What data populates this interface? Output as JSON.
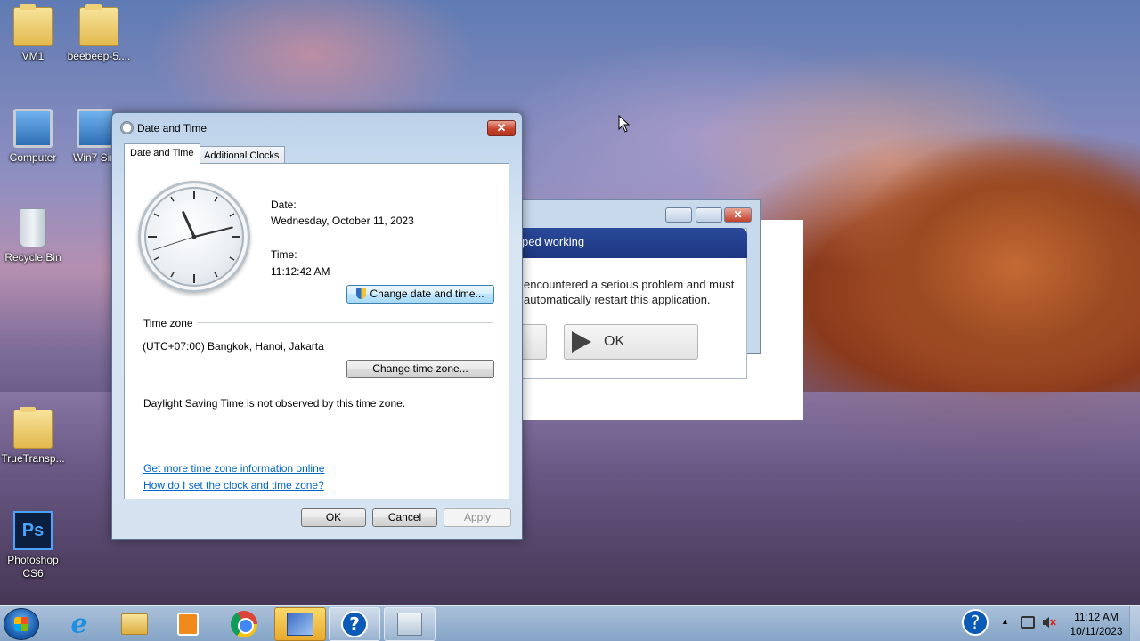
{
  "desktop": {
    "icons": [
      {
        "label": "VM1"
      },
      {
        "label": "beebeep-5...."
      },
      {
        "label": "Computer"
      },
      {
        "label": "Win7 Sim"
      },
      {
        "label": "Recycle Bin"
      },
      {
        "label": "TrueTransp..."
      },
      {
        "label": "Photoshop CS6"
      }
    ]
  },
  "error_window": {
    "banner": "ped working",
    "message": "encountered a serious problem and must\nautomatically restart this application.",
    "ok_label": "OK",
    "close_glyph": "✕"
  },
  "dialog": {
    "title": "Date and Time",
    "close_glyph": "✕",
    "tabs": [
      "Date and Time",
      "Additional Clocks"
    ],
    "date_label": "Date:",
    "date_value": "Wednesday, October 11, 2023",
    "time_label": "Time:",
    "time_value": "11:12:42 AM",
    "change_datetime_button": "Change date and time...",
    "timezone_header": "Time zone",
    "timezone_value": "(UTC+07:00) Bangkok, Hanoi, Jakarta",
    "change_timezone_button": "Change time zone...",
    "dst_text": "Daylight Saving Time is not observed by this time zone.",
    "links": [
      "Get more time zone information online",
      "How do I set the clock and time zone?"
    ],
    "ok": "OK",
    "cancel": "Cancel",
    "apply": "Apply"
  },
  "clock": {
    "hours": 11,
    "minutes": 12,
    "seconds": 42
  },
  "taskbar": {
    "items": [
      "start-button",
      "internet-explorer-icon",
      "windows-explorer-icon",
      "media-player-icon",
      "chrome-icon",
      "active-app-icon",
      "help-icon",
      "date-time-icon"
    ],
    "help_glyph": "?",
    "tray_help_glyph": "?",
    "tray_chevron": "▲",
    "time": "11:12 AM",
    "date": "10/11/2023"
  },
  "colors": {
    "accent": "#0b5ab8",
    "link": "#0066cc",
    "close_red": "#c7442e"
  }
}
